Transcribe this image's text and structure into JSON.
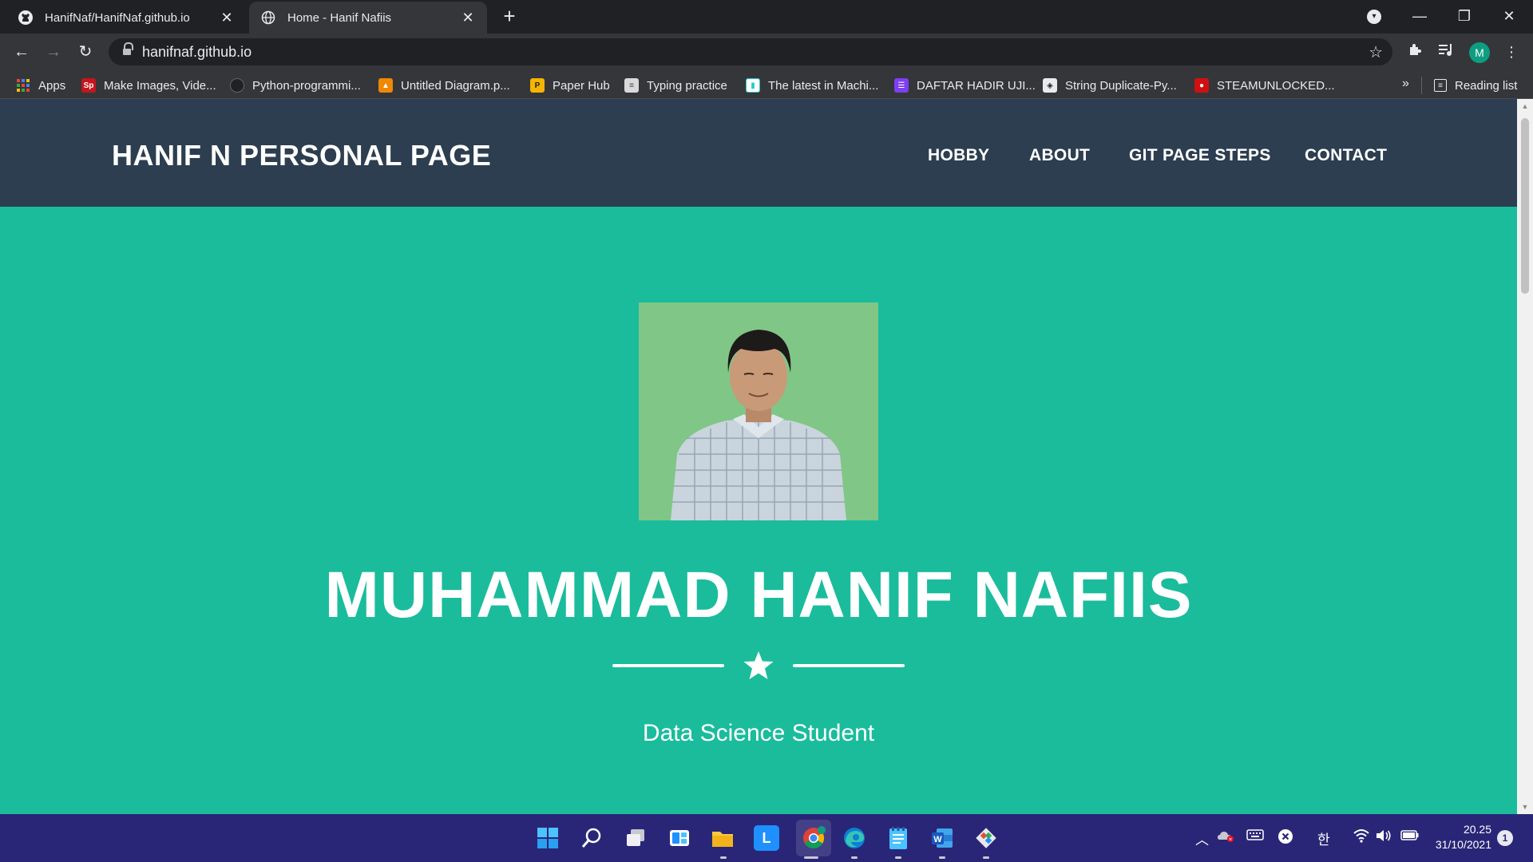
{
  "browser": {
    "tabs": [
      {
        "title": "HanifNaf/HanifNaf.github.io",
        "icon": "github-icon",
        "active": false
      },
      {
        "title": "Home - Hanif Nafiis",
        "icon": "globe-icon",
        "active": true
      }
    ],
    "url": "hanifnaf.github.io",
    "profile_initial": "M",
    "bookmarks": [
      {
        "label": "Apps",
        "icon": "apps-grid-icon"
      },
      {
        "label": "Make Images, Vide...",
        "icon": "sp-icon"
      },
      {
        "label": "Python-programmi...",
        "icon": "github-icon"
      },
      {
        "label": "Untitled Diagram.p...",
        "icon": "drawio-icon"
      },
      {
        "label": "Paper Hub",
        "icon": "paper-hub-icon"
      },
      {
        "label": "Typing practice",
        "icon": "document-icon"
      },
      {
        "label": "The latest in Machi...",
        "icon": "paperswithcode-icon"
      },
      {
        "label": "DAFTAR HADIR UJI...",
        "icon": "forms-list-icon"
      },
      {
        "label": "String Duplicate-Py...",
        "icon": "diamond-icon"
      },
      {
        "label": "STEAMUNLOCKED...",
        "icon": "steam-lock-icon"
      }
    ],
    "more_bookmarks": "»",
    "reading_list": "Reading list"
  },
  "site": {
    "brand": "HANIF N PERSONAL PAGE",
    "nav": [
      "HOBBY",
      "ABOUT",
      "GIT PAGE STEPS",
      "CONTACT"
    ],
    "name": "MUHAMMAD HANIF NAFIIS",
    "subtitle": "Data Science Student"
  },
  "taskbar": {
    "time": "20.25",
    "date": "31/10/2021",
    "notification_count": "1",
    "ime": "한"
  },
  "colors": {
    "hero_bg": "#1abc9c",
    "navbar_bg": "#2c3e50",
    "taskbar_bg": "#2a2677",
    "browser_frame": "#202124"
  }
}
